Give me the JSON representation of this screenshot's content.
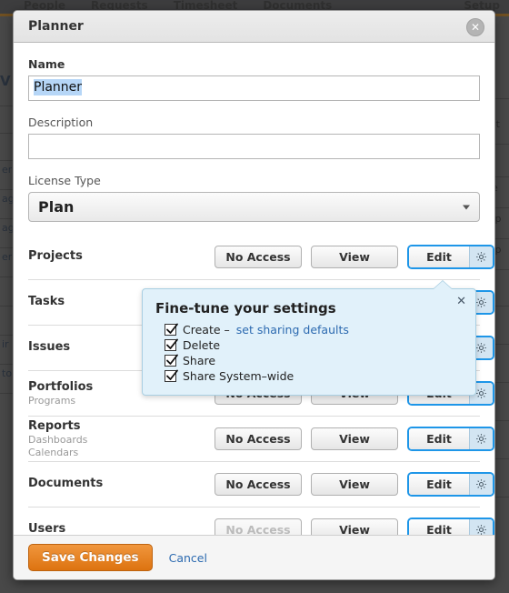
{
  "background": {
    "topnav": [
      "People",
      "Requests",
      "Timesheet",
      "Documents"
    ],
    "topnav_right": "Setup",
    "left_fragments": [
      "V",
      "er",
      "ag",
      "ag",
      "er",
      "ir",
      "to"
    ],
    "right_fragments": [
      "Filt",
      "be",
      "n p",
      "n p"
    ]
  },
  "modal": {
    "title": "Planner",
    "close_icon": "close-icon",
    "name": {
      "label": "Name",
      "value": "Planner",
      "placeholder": ""
    },
    "description": {
      "label": "Description",
      "value": "",
      "placeholder": ""
    },
    "license_type": {
      "label": "License Type",
      "selected": "Plan",
      "caret_icon": "chevron-down-icon"
    },
    "buttons": {
      "no_access": "No Access",
      "view": "View",
      "edit": "Edit",
      "gear_icon": "gear-icon"
    },
    "rows": [
      {
        "name": "Projects",
        "sub": [],
        "selected": "Edit",
        "no_access_disabled": false
      },
      {
        "name": "Tasks",
        "sub": [],
        "selected": "Edit",
        "no_access_disabled": false
      },
      {
        "name": "Issues",
        "sub": [],
        "selected": "Edit",
        "no_access_disabled": false
      },
      {
        "name": "Portfolios",
        "sub": [
          "Programs"
        ],
        "selected": "Edit",
        "no_access_disabled": false
      },
      {
        "name": "Reports",
        "sub": [
          "Dashboards",
          "Calendars"
        ],
        "selected": "Edit",
        "no_access_disabled": false
      },
      {
        "name": "Documents",
        "sub": [],
        "selected": "Edit",
        "no_access_disabled": false
      },
      {
        "name": "Users",
        "sub": [],
        "selected": "Edit",
        "no_access_disabled": true
      }
    ],
    "popover": {
      "title": "Fine-tune your settings",
      "close_icon": "close-icon",
      "items": [
        {
          "label_plain": "Create – ",
          "label_link": "set sharing defaults",
          "checked": true
        },
        {
          "label_plain": "Delete",
          "label_link": "",
          "checked": true
        },
        {
          "label_plain": "Share",
          "label_link": "",
          "checked": true
        },
        {
          "label_plain": "Share System–wide",
          "label_link": "",
          "checked": true
        }
      ]
    },
    "footer": {
      "save_label": "Save Changes",
      "cancel_label": "Cancel"
    }
  },
  "colors": {
    "accent_blue": "#1e96e8",
    "save_orange": "#dd7310",
    "link_blue": "#2c6ab0",
    "popover_bg": "#e1f1fa",
    "selection_blue": "#b6d6f7"
  }
}
